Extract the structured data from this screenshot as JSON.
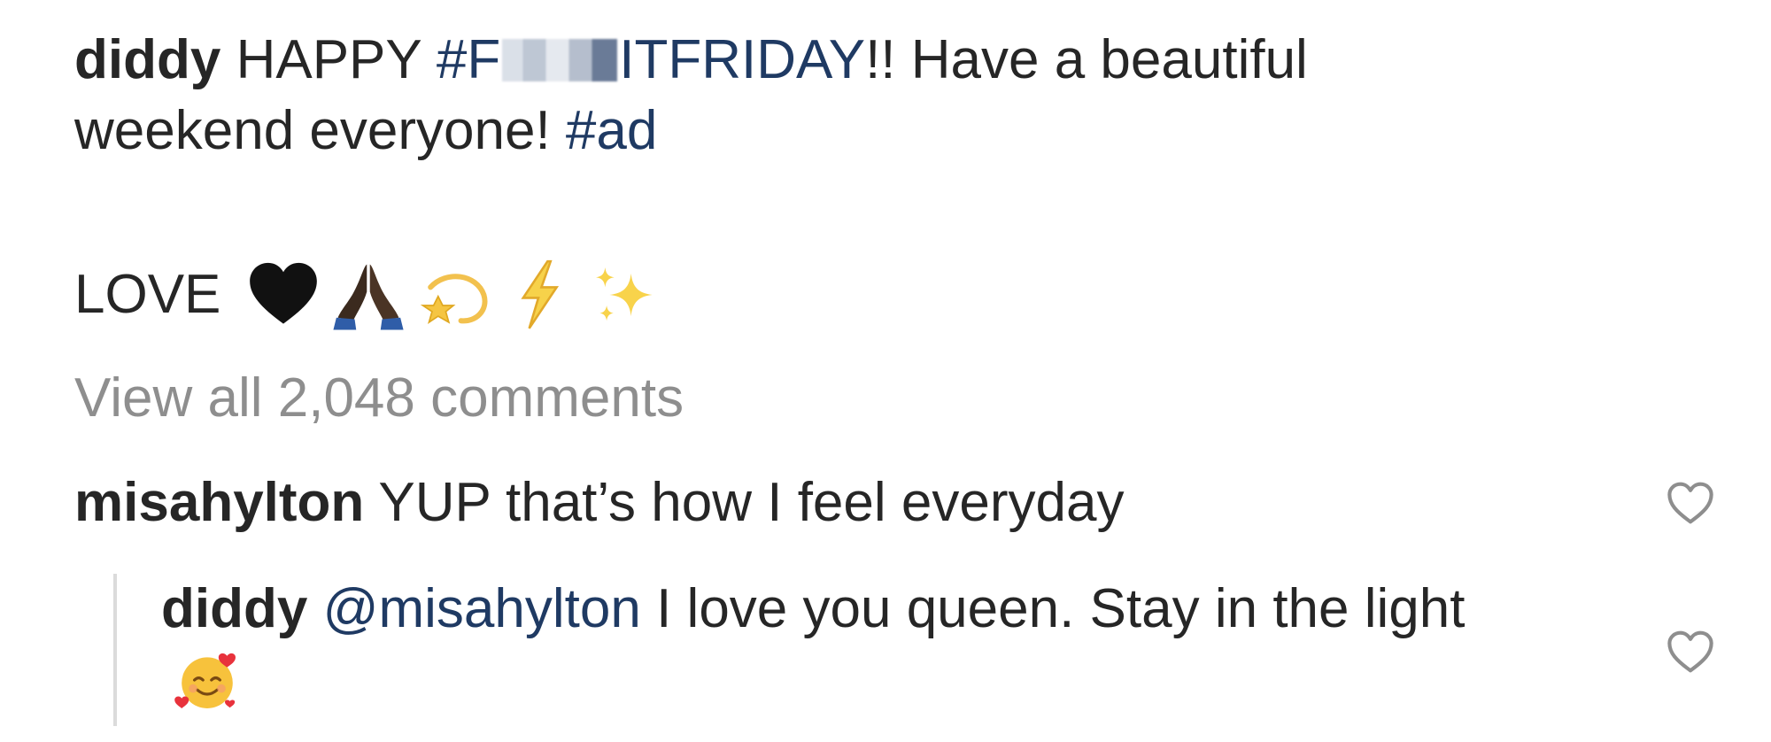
{
  "post": {
    "caption": {
      "username": "diddy",
      "text_before": "HAPPY ",
      "hashtag_prefix": "#F",
      "hashtag_suffix": "ITFRIDAY",
      "text_after_hashtag": "!! Have a beautiful weekend everyone! ",
      "ad_tag": "#ad"
    },
    "love_text": "LOVE",
    "love_emojis": [
      "black-heart-emoji",
      "folded-hands-emoji",
      "dizzy-emoji",
      "high-voltage-emoji",
      "sparkles-emoji"
    ]
  },
  "comments": {
    "view_all_label": "View all 2,048 comments",
    "items": [
      {
        "username": "misahylton",
        "text": "YUP that’s how I feel everyday",
        "like_icon": "heart-outline-icon"
      }
    ],
    "replies": [
      {
        "username": "diddy",
        "mention": "@misahylton",
        "text": "I love you queen. Stay in the light",
        "emoji": "smiling-face-with-hearts-emoji",
        "like_icon": "heart-outline-icon"
      }
    ]
  },
  "colors": {
    "text": "#262626",
    "link": "#1f3a63",
    "muted": "#8e8e8e",
    "thread_bar": "#dbdbdb"
  }
}
